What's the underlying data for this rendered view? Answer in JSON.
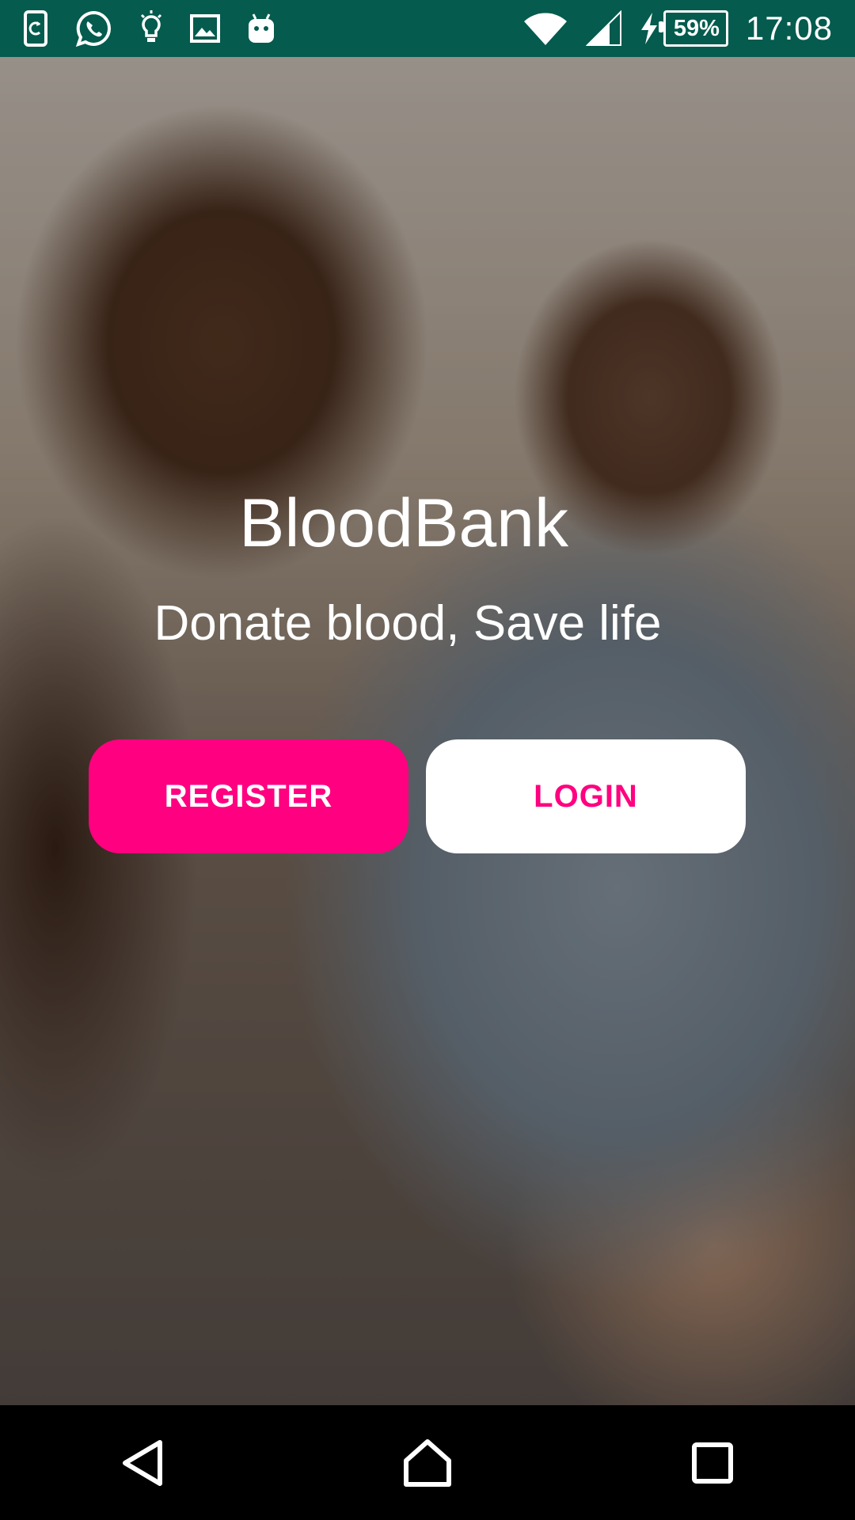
{
  "status_bar": {
    "left_icons": [
      "sim-update-icon",
      "whatsapp-icon",
      "lightbulb-icon",
      "image-icon",
      "android-icon"
    ],
    "right_icons": [
      "wifi-icon",
      "cell-signal-icon",
      "charging-bolt-icon"
    ],
    "battery_percent": "59%",
    "time": "17:08",
    "background_color": "#045b4e"
  },
  "hero": {
    "app_name": "BloodBank",
    "tagline": "Donate blood, Save life",
    "register_label": "REGISTER",
    "login_label": "LOGIN",
    "accent_color": "#ff0080"
  },
  "nav_bar": {
    "buttons": [
      "back-icon",
      "home-icon",
      "recents-icon"
    ]
  }
}
